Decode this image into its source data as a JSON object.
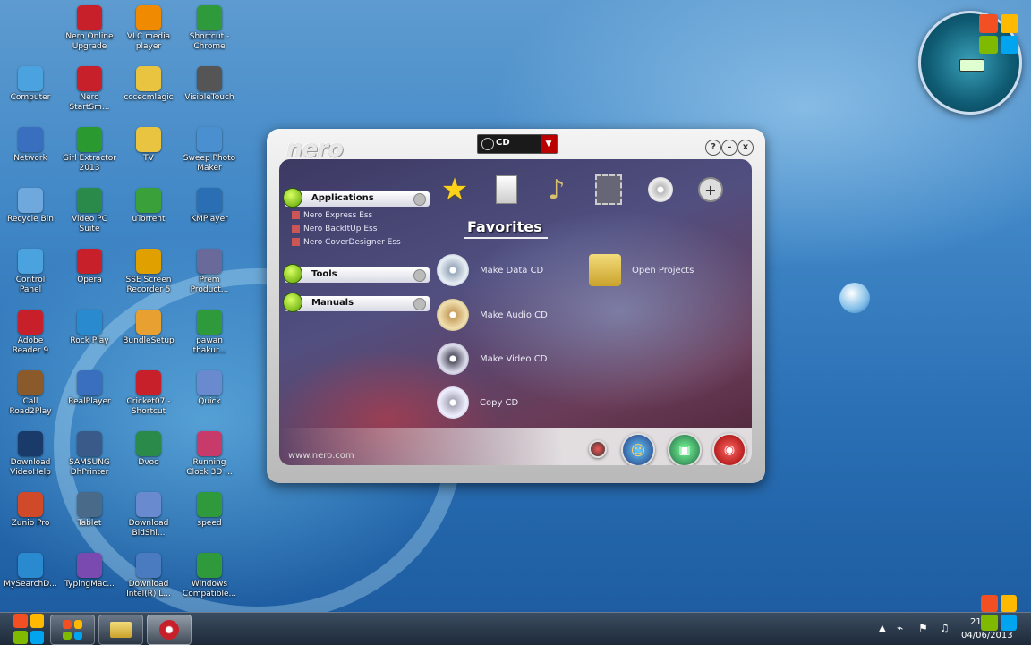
{
  "desktop": {
    "icons": [
      {
        "label": "",
        "color": "#3a7bd5"
      },
      {
        "label": "Nero Online\nUpgrade",
        "color": "#c8202a"
      },
      {
        "label": "VLC media\nplayer",
        "color": "#f08a00"
      },
      {
        "label": "Shortcut -\nChrome",
        "color": "#2f9a3c"
      },
      {
        "label": "Computer",
        "color": "#4aa3df"
      },
      {
        "label": "Nero\nStartSm...",
        "color": "#c8202a"
      },
      {
        "label": "cccecmlagic",
        "color": "#e8c441"
      },
      {
        "label": "VisibleTouch",
        "color": "#555555"
      },
      {
        "label": "Network",
        "color": "#3a6fc0"
      },
      {
        "label": "Girl Extractor\n2013",
        "color": "#2a9a30"
      },
      {
        "label": "TV",
        "color": "#e8c441"
      },
      {
        "label": "Sweep Photo\nMaker",
        "color": "#4a90d0"
      },
      {
        "label": "Recycle Bin",
        "color": "#6fa8dc"
      },
      {
        "label": "Video PC\nSuite",
        "color": "#2a8a4a"
      },
      {
        "label": "uTorrent",
        "color": "#3aa03a"
      },
      {
        "label": "KMPlayer",
        "color": "#2a6fb4"
      },
      {
        "label": "Control\nPanel",
        "color": "#4aa3df"
      },
      {
        "label": "Opera",
        "color": "#c8202a"
      },
      {
        "label": "SSE Screen\nRecorder 5",
        "color": "#e0a000"
      },
      {
        "label": "Prem\nProduct...",
        "color": "#6a6a9a"
      },
      {
        "label": "Adobe\nReader 9",
        "color": "#c8202a"
      },
      {
        "label": "Rock Play",
        "color": "#2a8ad0"
      },
      {
        "label": "BundleSetup",
        "color": "#e8a030"
      },
      {
        "label": "pawan\nthakur...",
        "color": "#2f9a3c"
      },
      {
        "label": "Call\nRoad2Play",
        "color": "#8a5a2a"
      },
      {
        "label": "RealPlayer",
        "color": "#3a6fc0"
      },
      {
        "label": "Cricket07 -\nShortcut",
        "color": "#c8202a"
      },
      {
        "label": "Quick",
        "color": "#6a8ad0"
      },
      {
        "label": "Download\nVideoHelp",
        "color": "#1a3a6a"
      },
      {
        "label": "SAMSUNG\nDhPrinter",
        "color": "#3a5a8a"
      },
      {
        "label": "Dvoo",
        "color": "#2a8a4a"
      },
      {
        "label": "Running\nClock 3D ...",
        "color": "#c83a6a"
      },
      {
        "label": "Zunio Pro",
        "color": "#d04a2a"
      },
      {
        "label": "Tablet",
        "color": "#4a6a8a"
      },
      {
        "label": "Download\nBidShl...",
        "color": "#6a8ad0"
      },
      {
        "label": "speed",
        "color": "#2f9a3c"
      },
      {
        "label": "MySearchD...",
        "color": "#2a8ad0"
      },
      {
        "label": "TypingMac...",
        "color": "#7a4ab0"
      },
      {
        "label": "Download\nIntel(R) L...",
        "color": "#4a7ac0"
      },
      {
        "label": "Windows\nCompatible...",
        "color": "#2f9a3c"
      }
    ]
  },
  "nero": {
    "logo": "nero",
    "dropdown_value": "CD",
    "controls": [
      "?",
      "–",
      "x"
    ],
    "sections": {
      "applications": "Applications",
      "tools": "Tools",
      "manuals": "Manuals"
    },
    "app_items": [
      "Nero Express Ess",
      "Nero BackItUp Ess",
      "Nero CoverDesigner Ess"
    ],
    "tab_title": "Favorites",
    "tasks": {
      "make_data_cd": "Make Data CD",
      "make_audio_cd": "Make Audio CD",
      "make_video_cd": "Make Video CD",
      "copy_cd": "Copy CD",
      "open_projects": "Open Projects"
    },
    "footer_url": "www.nero.com"
  },
  "taskbar": {
    "time": "21",
    "date": "04/06/2013"
  },
  "colors": {
    "accent": "#c8202a",
    "win_red": "#f25022",
    "win_green": "#7fba00",
    "win_blue": "#00a4ef",
    "win_yellow": "#ffb900"
  }
}
